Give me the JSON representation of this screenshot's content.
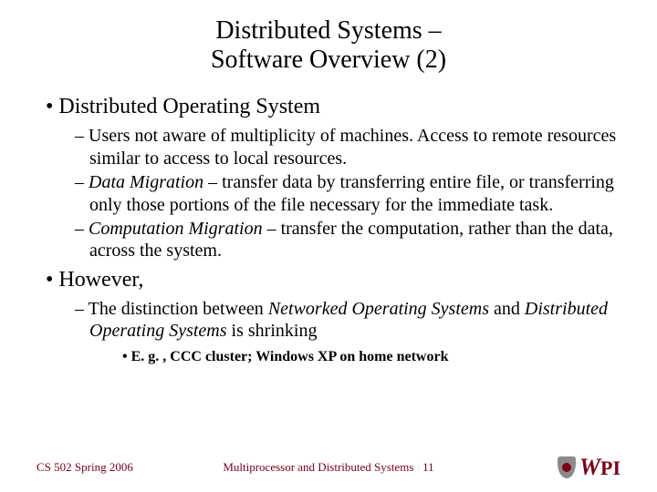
{
  "title_line1": "Distributed Systems –",
  "title_line2": "Software Overview (2)",
  "bullets": [
    {
      "text": "Distributed Operating System",
      "sub": [
        {
          "plain_a": "Users not aware of multiplicity of machines.  Access to remote resources similar to access to local resources."
        },
        {
          "em": "Data Migration",
          "rest": " – transfer data by transferring entire file, or transferring only those portions of the file necessary for the immediate task."
        },
        {
          "em": "Computation Migration",
          "rest": " – transfer the computation, rather than the data, across the system."
        }
      ]
    },
    {
      "text": "However,",
      "sub": [
        {
          "plain_a": "The distinction between ",
          "em": "Networked Operating Systems",
          "mid": " and ",
          "em2": "Distributed Operating Systems",
          "rest": " is shrinking",
          "subsub": [
            "E. g. , CCC cluster; Windows XP on home network"
          ]
        }
      ]
    }
  ],
  "footer": {
    "left": "CS 502 Spring 2006",
    "center_prefix": "Multiprocessor and Distributed Systems",
    "page": "11",
    "logo_text": "WPI"
  }
}
